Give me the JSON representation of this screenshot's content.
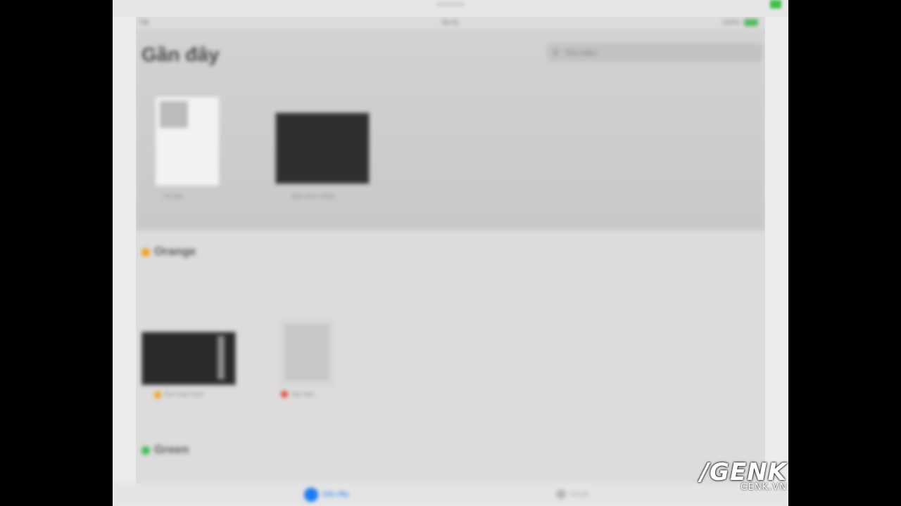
{
  "status_bar": {
    "carrier": "Tắt",
    "time": "09:41",
    "battery_percent": "100%"
  },
  "header": {
    "title": "Gần đây",
    "search_placeholder": "Tìm kiếm",
    "search_icon": "magnifier"
  },
  "recent_files": [
    {
      "name": "Tài liệu",
      "kind": "document"
    },
    {
      "name": "Bản trình chiếu",
      "kind": "presentation"
    }
  ],
  "sections": [
    {
      "title": "Orange",
      "tag_color": "#f2a11d",
      "files": [
        {
          "name": "Ảnh màn hình",
          "kind": "presentation",
          "tag_color": "#f2a11d"
        },
        {
          "name": "Văn bản",
          "kind": "document",
          "tag_color": "#e84b3c"
        }
      ]
    },
    {
      "title": "Green",
      "tag_color": "#3fbf4a"
    }
  ],
  "tab_bar": [
    {
      "label": "Gần đây",
      "icon": "clock-icon",
      "active": true,
      "color": "#1a7cf5"
    },
    {
      "label": "Duyệt",
      "icon": "folder-icon",
      "active": false,
      "color": "#a8a8a8"
    }
  ],
  "watermark": {
    "logo": "/GENK",
    "site": "GENK.VN"
  }
}
